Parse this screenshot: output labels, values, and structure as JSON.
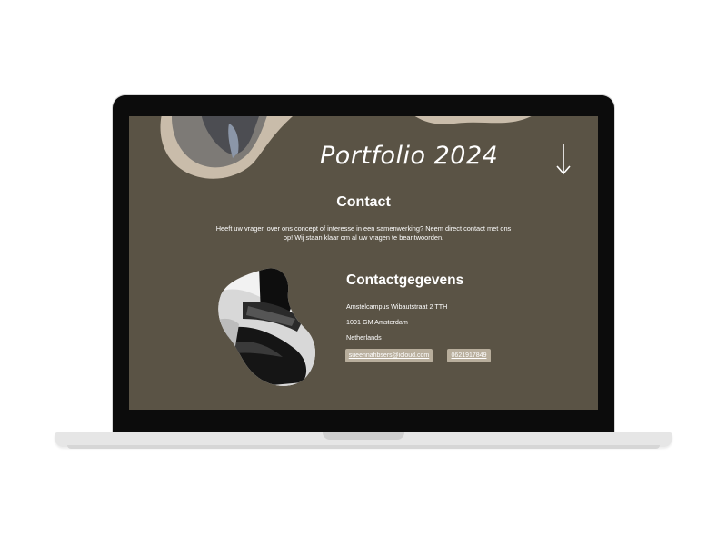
{
  "site": {
    "title": "Portfolio 2024",
    "nav_icon": "arrow-down-icon"
  },
  "contact": {
    "heading": "Contact",
    "intro": "Heeft uw vragen over ons concept of interesse in een samenwerking? Neem direct contact met ons op! Wij staan klaar om al uw vragen te beantwoorden."
  },
  "details": {
    "heading": "Contactgegevens",
    "address_line1": "Amstelcampus Wibautstraat 2 TTH",
    "address_line2": "1091 GM Amsterdam",
    "country": "Netherlands",
    "email": "sueennahbsers@icloud.com",
    "phone": "0621917849"
  },
  "colors": {
    "page_background": "#5a5345",
    "pill_background": "#b8ae9c",
    "blob_beige": "#c9bcaa",
    "text": "#ffffff"
  }
}
